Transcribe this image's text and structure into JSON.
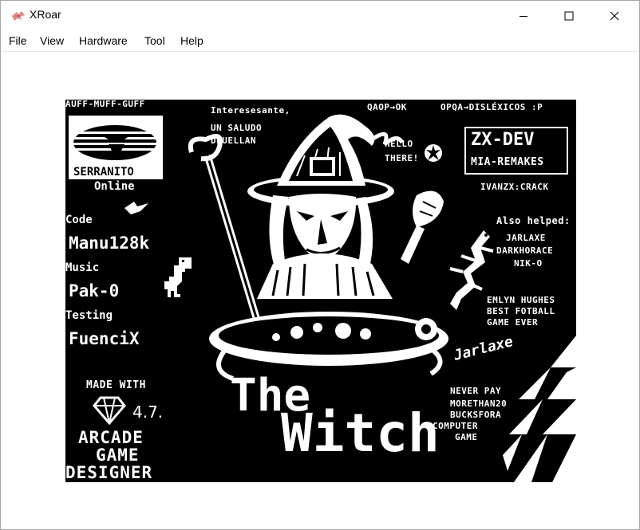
{
  "window": {
    "title": "XRoar",
    "controls": {
      "minimize": "minimize",
      "maximize": "maximize",
      "close": "close"
    }
  },
  "menubar": {
    "items": [
      "File",
      "View",
      "Hardware",
      "Tool",
      "Help"
    ]
  },
  "screen": {
    "top_left": "AUFF-MUFF-GUFF",
    "greeting": [
      "Interesesante,",
      "UN SALUDO",
      "DRUELLAN"
    ],
    "top_right_1": "QAOP→OK",
    "top_right_2": "OPQA→DISLÉXICOS :P",
    "hello": [
      "HELLO",
      "THERE!"
    ],
    "zxdev": "ZX-DEV",
    "mia": "MIA-REMAKES",
    "ivanzx": "IVANZX:CRACK",
    "logo_name": "SERRANITO",
    "logo_sub": "Online",
    "code_label": "Code",
    "code_name": "Manu128k",
    "music_label": "Music",
    "music_name": "Pak-0",
    "testing_label": "Testing",
    "testing_name": "FuenciX",
    "also_label": "Also helped:",
    "helpers": [
      "JARLAXE",
      "DARKHORACE",
      "NIK-O"
    ],
    "emlyn": [
      "EMLYN HUGHES",
      "BEST FOTBALL",
      "GAME EVER"
    ],
    "signature": "Jarlaxe",
    "never": [
      "NEVER PAY",
      "MORETHAN20",
      "BUCKSFORA",
      "COMPUTER",
      "GAME"
    ],
    "made_with": "MADE  WITH",
    "version": "4.7.",
    "agd": [
      "ARCADE",
      "GAME",
      "DESIGNER"
    ],
    "title_the": "The",
    "title_witch": "Witch"
  }
}
